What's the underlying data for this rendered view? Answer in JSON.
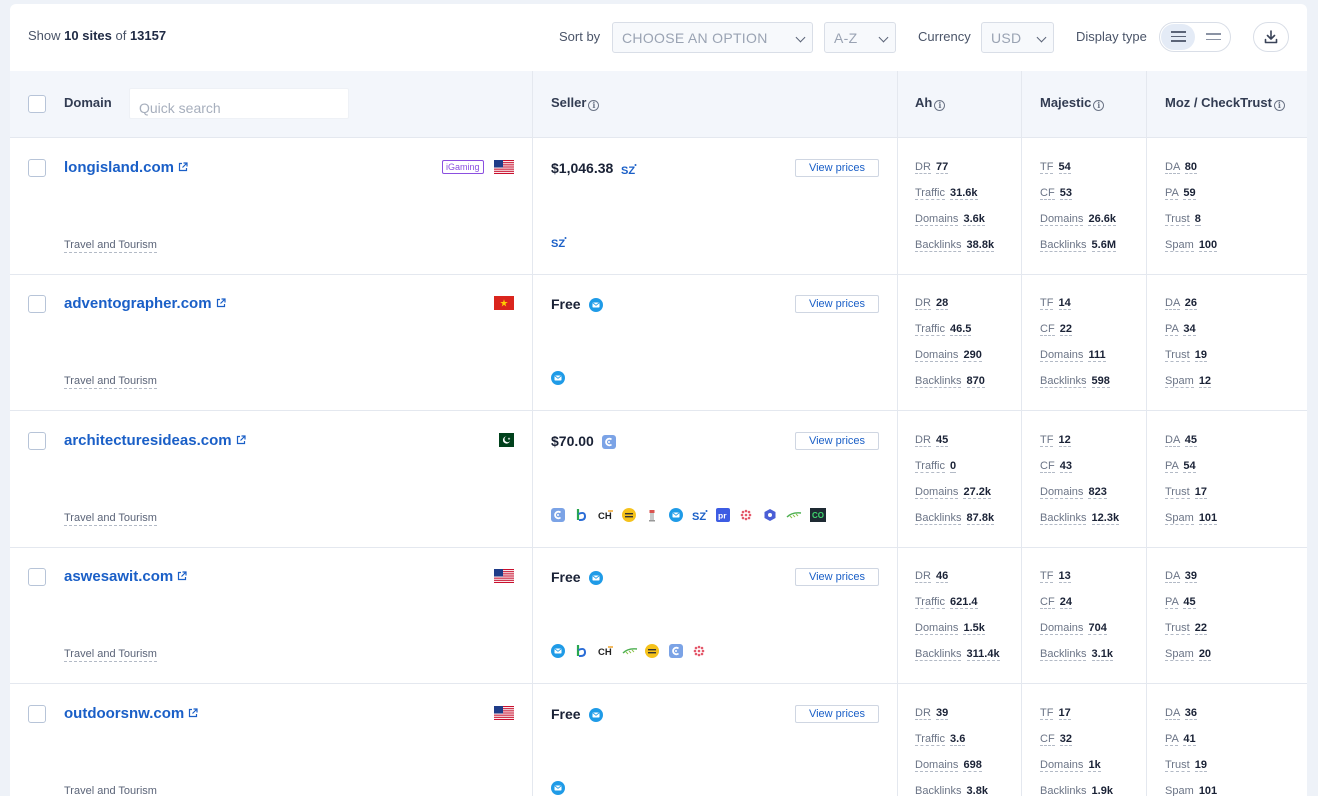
{
  "toolbar": {
    "show_prefix": "Show",
    "show_count": "10 sites",
    "show_of": "of",
    "show_total": "13157",
    "sort_by_label": "Sort by",
    "sort_option": "CHOOSE AN OPTION",
    "sort_order": "A-Z",
    "currency_label": "Currency",
    "currency_value": "USD",
    "display_type_label": "Display type"
  },
  "header": {
    "domain": "Domain",
    "quick_search_placeholder": "Quick search",
    "seller": "Seller",
    "ah": "Ah",
    "majestic": "Majestic",
    "moz": "Moz / CheckTrust",
    "info_glyph": "i"
  },
  "view_prices_label": "View prices",
  "rows": [
    {
      "domain": "longisland.com",
      "category": "Travel and Tourism",
      "badge": "iGaming",
      "flag": "us",
      "price": "$1,046.38",
      "price_icon": "sz-icon",
      "seller_icons": [
        "sz-icon"
      ],
      "ah": {
        "dr": "77",
        "traffic": "31.6k",
        "domains": "3.6k",
        "backlinks": "38.8k"
      },
      "majestic": {
        "tf": "54",
        "cf": "53",
        "domains": "26.6k",
        "backlinks": "5.6M"
      },
      "moz": {
        "da": "80",
        "pa": "59",
        "trust": "8",
        "spam": "100"
      }
    },
    {
      "domain": "adventographer.com",
      "category": "Travel and Tourism",
      "badge": "",
      "flag": "vn",
      "price": "Free",
      "price_icon": "mail-icon",
      "seller_icons": [
        "mail-icon"
      ],
      "ah": {
        "dr": "28",
        "traffic": "46.5",
        "domains": "290",
        "backlinks": "870"
      },
      "majestic": {
        "tf": "14",
        "cf": "22",
        "domains": "111",
        "backlinks": "598"
      },
      "moz": {
        "da": "26",
        "pa": "34",
        "trust": "19",
        "spam": "12"
      }
    },
    {
      "domain": "architecturesideas.com",
      "category": "Travel and Tourism",
      "badge": "",
      "flag": "pk",
      "price": "$70.00",
      "price_icon": "collaborator-icon",
      "seller_icons": [
        "collaborator-icon",
        "b-icon",
        "ch-icon",
        "emoji-icon",
        "tower-icon",
        "mail-icon",
        "sz-icon",
        "pr-icon",
        "dots-icon",
        "hex-icon",
        "feather-icon",
        "co-icon"
      ],
      "ah": {
        "dr": "45",
        "traffic": "0",
        "domains": "27.2k",
        "backlinks": "87.8k"
      },
      "majestic": {
        "tf": "12",
        "cf": "43",
        "domains": "823",
        "backlinks": "12.3k"
      },
      "moz": {
        "da": "45",
        "pa": "54",
        "trust": "17",
        "spam": "101"
      }
    },
    {
      "domain": "aswesawit.com",
      "category": "Travel and Tourism",
      "badge": "",
      "flag": "us",
      "price": "Free",
      "price_icon": "mail-icon",
      "seller_icons": [
        "mail-icon",
        "b-icon",
        "ch-icon",
        "feather-icon",
        "emoji-icon",
        "collaborator-icon",
        "dots-icon"
      ],
      "ah": {
        "dr": "46",
        "traffic": "621.4",
        "domains": "1.5k",
        "backlinks": "311.4k"
      },
      "majestic": {
        "tf": "13",
        "cf": "24",
        "domains": "704",
        "backlinks": "3.1k"
      },
      "moz": {
        "da": "39",
        "pa": "45",
        "trust": "22",
        "spam": "20"
      }
    },
    {
      "domain": "outdoorsnw.com",
      "category": "Travel and Tourism",
      "badge": "",
      "flag": "us",
      "price": "Free",
      "price_icon": "mail-icon",
      "seller_icons": [
        "mail-icon"
      ],
      "ah": {
        "dr": "39",
        "traffic": "3.6",
        "domains": "698",
        "backlinks": "3.8k"
      },
      "majestic": {
        "tf": "17",
        "cf": "32",
        "domains": "1k",
        "backlinks": "1.9k"
      },
      "moz": {
        "da": "36",
        "pa": "41",
        "trust": "19",
        "spam": "101"
      }
    }
  ],
  "metric_labels": {
    "dr": "DR",
    "traffic": "Traffic",
    "domains": "Domains",
    "backlinks": "Backlinks",
    "tf": "TF",
    "cf": "CF",
    "da": "DA",
    "pa": "PA",
    "trust": "Trust",
    "spam": "Spam"
  },
  "colors": {
    "link": "#1a5fc7",
    "badge": "#8b4fe0",
    "mail": "#1f9be7"
  }
}
